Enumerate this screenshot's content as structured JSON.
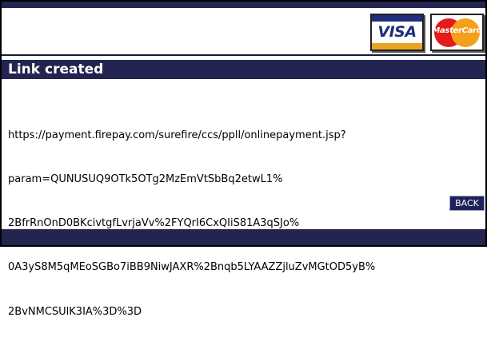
{
  "header": {
    "cards": [
      {
        "name": "visa",
        "label": "VISA"
      },
      {
        "name": "mastercard",
        "label": "MasterCard"
      }
    ]
  },
  "title": "Link created",
  "link_lines": [
    "https://payment.firepay.com/surefire/ccs/ppll/onlinepayment.jsp?",
    "param=QUNUSUQ9OTk5OTg2MzEmVtSbBq2etwL1%",
    "2BfrRnOnD0BKcivtgfLvrjaVv%2FYQrI6CxQIiS81A3qSJo%",
    "0A3yS8M5qMEoSGBo7iBB9NiwJAXR%2Bnqb5LYAAZZjluZvMGtOD5yB%",
    "2BvNMCSUlK3IA%3D%3D"
  ],
  "back_button": {
    "label": "BACK"
  },
  "colors": {
    "navy_bar": "#232450",
    "button_bg": "#1f2158",
    "visa_blue": "#1f2d7a",
    "visa_gold": "#e8a322",
    "mc_red": "#e21b1b",
    "mc_yellow": "#f5a01a"
  }
}
